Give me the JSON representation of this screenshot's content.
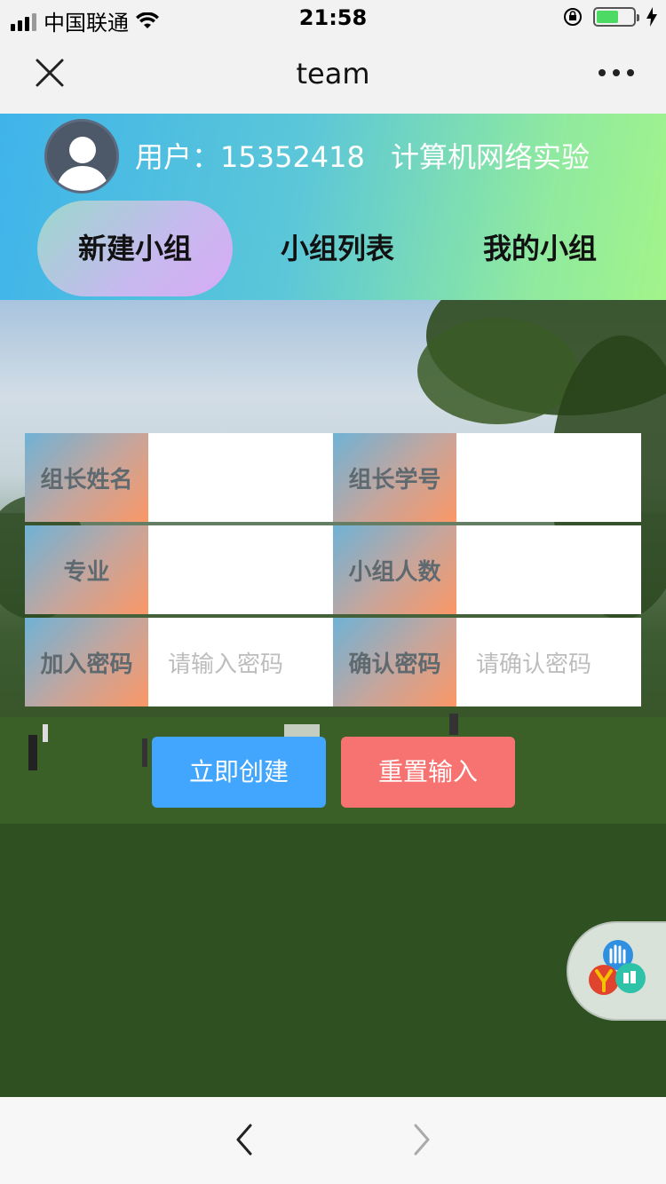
{
  "status_bar": {
    "carrier": "中国联通",
    "time": "21:58"
  },
  "nav": {
    "title": "team"
  },
  "header": {
    "user_label": "用户：15352418",
    "course_label": "计算机网络实验",
    "tabs": [
      {
        "label": "新建小组",
        "active": true
      },
      {
        "label": "小组列表",
        "active": false
      },
      {
        "label": "我的小组",
        "active": false
      }
    ]
  },
  "form": {
    "rows": [
      {
        "left_label": "组长姓名",
        "left_placeholder": "",
        "right_label": "组长学号",
        "right_placeholder": ""
      },
      {
        "left_label": "专业",
        "left_placeholder": "",
        "right_label": "小组人数",
        "right_placeholder": ""
      },
      {
        "left_label": "加入密码",
        "left_placeholder": "请输入密码",
        "right_label": "确认密码",
        "right_placeholder": "请确认密码"
      }
    ]
  },
  "buttons": {
    "create": "立即创建",
    "reset": "重置输入"
  },
  "colors": {
    "create_button": "#42a6ff",
    "reset_button": "#f77372",
    "header_gradient_start": "#3fb4ea",
    "header_gradient_end": "#a2f48a"
  }
}
